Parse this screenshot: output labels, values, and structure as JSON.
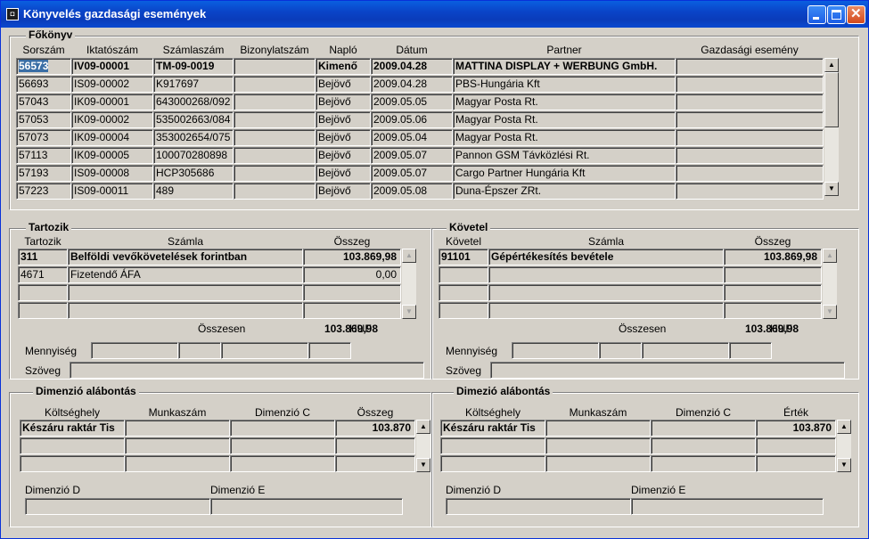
{
  "window": {
    "title": "Könyvelés gazdasági események",
    "app_icon": "oracle-forms-icon"
  },
  "fokonyv": {
    "label": "Főkönyv",
    "columns": [
      "Sorszám",
      "Iktatószám",
      "Számlaszám",
      "Bizonylatszám",
      "Napló",
      "Dátum",
      "Partner",
      "Gazdasági esemény"
    ],
    "rows": [
      {
        "sorszam": "56573",
        "iktato": "IV09-00001",
        "szamla": "TM-09-0019",
        "bizonylat": "",
        "naplo": "Kimenő",
        "datum": "2009.04.28",
        "partner": "MATTINA DISPLAY + WERBUNG GmbH.",
        "esemeny": ""
      },
      {
        "sorszam": "56693",
        "iktato": "IS09-00002",
        "szamla": "K917697",
        "bizonylat": "",
        "naplo": "Bejövő",
        "datum": "2009.04.28",
        "partner": "PBS-Hungária Kft",
        "esemeny": ""
      },
      {
        "sorszam": "57043",
        "iktato": "IK09-00001",
        "szamla": "643000268/092",
        "bizonylat": "",
        "naplo": "Bejövő",
        "datum": "2009.05.05",
        "partner": "Magyar Posta Rt.",
        "esemeny": ""
      },
      {
        "sorszam": "57053",
        "iktato": "IK09-00002",
        "szamla": "535002663/084",
        "bizonylat": "",
        "naplo": "Bejövő",
        "datum": "2009.05.06",
        "partner": "Magyar Posta Rt.",
        "esemeny": ""
      },
      {
        "sorszam": "57073",
        "iktato": "IK09-00004",
        "szamla": "353002654/075",
        "bizonylat": "",
        "naplo": "Bejövő",
        "datum": "2009.05.04",
        "partner": "Magyar Posta Rt.",
        "esemeny": ""
      },
      {
        "sorszam": "57113",
        "iktato": "IK09-00005",
        "szamla": "100070280898",
        "bizonylat": "",
        "naplo": "Bejövő",
        "datum": "2009.05.07",
        "partner": "Pannon GSM Távközlési Rt.",
        "esemeny": ""
      },
      {
        "sorszam": "57193",
        "iktato": "IS09-00008",
        "szamla": "HCP305686",
        "bizonylat": "",
        "naplo": "Bejövő",
        "datum": "2009.05.07",
        "partner": "Cargo Partner Hungária Kft",
        "esemeny": ""
      },
      {
        "sorszam": "57223",
        "iktato": "IS09-00011",
        "szamla": "489",
        "bizonylat": "",
        "naplo": "Bejövő",
        "datum": "2009.05.08",
        "partner": "Duna-Épszer ZRt.",
        "esemeny": ""
      }
    ]
  },
  "tartozik": {
    "label": "Tartozik",
    "columns": [
      "Tartozik",
      "Számla",
      "Összeg"
    ],
    "rows": [
      {
        "kod": "311",
        "szamla": "Belföldi vevőkövetelések forintban",
        "osszeg": "103.869,98"
      },
      {
        "kod": "4671",
        "szamla": "Fizetendő ÁFA",
        "osszeg": "0,00"
      },
      {
        "kod": "",
        "szamla": "",
        "osszeg": ""
      },
      {
        "kod": "",
        "szamla": "",
        "osszeg": ""
      }
    ],
    "osszesen_label": "Összesen",
    "osszesen": "103.869,98",
    "currency": "HUF",
    "mennyiseg_label": "Mennyiség",
    "szoveg_label": "Szöveg"
  },
  "kovetel": {
    "label": "Követel",
    "columns": [
      "Követel",
      "Számla",
      "Összeg"
    ],
    "rows": [
      {
        "kod": "91101",
        "szamla": "Gépértékesítés bevétele",
        "osszeg": "103.869,98"
      },
      {
        "kod": "",
        "szamla": "",
        "osszeg": ""
      },
      {
        "kod": "",
        "szamla": "",
        "osszeg": ""
      },
      {
        "kod": "",
        "szamla": "",
        "osszeg": ""
      }
    ],
    "osszesen_label": "Összesen",
    "osszesen": "103.869,98",
    "currency": "HUF",
    "mennyiseg_label": "Mennyiség",
    "szoveg_label": "Szöveg"
  },
  "dim_left": {
    "label": "Dimenzió alábontás",
    "columns": [
      "Költséghely",
      "Munkaszám",
      "Dimenzió C",
      "Összeg"
    ],
    "rows": [
      {
        "koltseghely": "Készáru raktár Tis",
        "munkaszam": "",
        "dimc": "",
        "ertek": "103.870"
      },
      {
        "koltseghely": "",
        "munkaszam": "",
        "dimc": "",
        "ertek": ""
      },
      {
        "koltseghely": "",
        "munkaszam": "",
        "dimc": "",
        "ertek": ""
      }
    ],
    "dim_d_label": "Dimenzió D",
    "dim_e_label": "Dimenzió E"
  },
  "dim_right": {
    "label": "Dimezió alábontás",
    "columns": [
      "Költséghely",
      "Munkaszám",
      "Dimenzió C",
      "Érték"
    ],
    "rows": [
      {
        "koltseghely": "Készáru raktár Tis",
        "munkaszam": "",
        "dimc": "",
        "ertek": "103.870"
      },
      {
        "koltseghely": "",
        "munkaszam": "",
        "dimc": "",
        "ertek": ""
      },
      {
        "koltseghely": "",
        "munkaszam": "",
        "dimc": "",
        "ertek": ""
      }
    ],
    "dim_d_label": "Dimenzió D",
    "dim_e_label": "Dimenzió E"
  }
}
